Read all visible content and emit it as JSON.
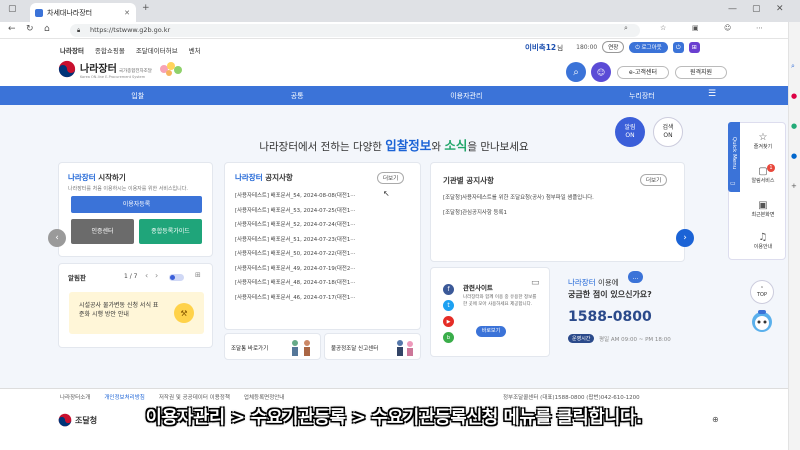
{
  "browser": {
    "tab_title": "차세대나라장터",
    "url": "https://tstwww.g2b.go.kr"
  },
  "site": {
    "top_links": [
      "나라장터",
      "종합쇼핑몰",
      "조달데이터허브",
      "벤처"
    ],
    "user_name": "이비축12",
    "user_suffix": "님",
    "timer": "180:00",
    "extend_label": "연장",
    "logout_label": "로그아웃",
    "logo_title": "나라장터",
    "logo_sub": "국가종합전자조달",
    "logo_sub2": "Korea ON-line E-Procurement System",
    "customer_center": "e-고객센터",
    "remote_support": "원격지원",
    "main_nav": [
      "입찰",
      "공통",
      "이용자관리",
      "누리장터"
    ]
  },
  "hero": {
    "title_pre": "나라장터에서 전하는 다양한 ",
    "title_hl1": "입찰정보",
    "title_mid": "와 ",
    "title_hl2": "소식",
    "title_post": "을 만나보세요",
    "alarm_label": "알림",
    "alarm_state": "ON",
    "search_label": "검색",
    "search_state": "ON"
  },
  "start_card": {
    "title_blue": "나라장터",
    "title_rest": " 시작하기",
    "desc": "나라장터를 처음 이용하시는 이용자를 위한 서비스입니다.",
    "btn_register": "이용자등록",
    "btn_cert": "인증센터",
    "btn_guide": "종합등록가이드"
  },
  "alarm_card": {
    "title": "알림판",
    "pager": "1 / 7",
    "content": "시설공사 물가변동 신청 서식 표준화 시행 방안 안내"
  },
  "notice_card": {
    "title_blue": "나라장터",
    "title_rest": " 공지사항",
    "more": "더보기",
    "items": [
      "[사용자테스트] 배포문서_54, 2024-08-08(대전1···",
      "[사용자테스트] 배포문서_53, 2024-07-25(대전1···",
      "[사용자테스트] 배포문서_52, 2024-07-24(대전1···",
      "[사용자테스트] 배포문서_51, 2024-07-23(대전1···",
      "[사용자테스트] 배포문서_50, 2024-07-22(대전1···",
      "[사용자테스트] 배포문서_49, 2024-07-19(대전2···",
      "[사용자테스트] 배포문서_48, 2024-07-18(대전1···",
      "[사용자테스트] 배포문서_46, 2024-07-17(대전1···"
    ]
  },
  "agency_card": {
    "title": "기관별 공지사항",
    "more": "더보기",
    "items": [
      "[조달청]사용자테스트를 위한 조달요청(공사) 첨부파일 샘플입니다.",
      "[조달청]관심공지사항 등록1"
    ]
  },
  "banners": {
    "left": "조달통 바로가기",
    "right": "불공정조달 신고센터"
  },
  "related": {
    "title": "관련사이트",
    "desc": "나라장터와 함께 이용 중 유용한 정보를 한 곳에 모아 사용하세요 제공합니다.",
    "btn": "바로보기"
  },
  "callcenter": {
    "line1_blue": "나라장터",
    "line1_rest": " 이용에",
    "line2": "궁금한 점이 있으신가요?",
    "phone": "1588-0800",
    "hours_label": "운영시간",
    "hours": "평일 AM 09:00 ~ PM 18:00"
  },
  "quick_menu": {
    "tab_label": "Quick Menu",
    "items": [
      "즐겨찾기",
      "알림서비스",
      "최근본화면",
      "이용안내"
    ],
    "badge": "1",
    "top": "TOP"
  },
  "footer": {
    "links": [
      "나라장터소개",
      "개인정보처리방침",
      "저작권 및 공공데이터 이용정책",
      "업체등록면정안내"
    ],
    "contact": "정부조달콜센터 (대표)1588-0800 (팝번)042-610-1200",
    "org": "조달청"
  },
  "subtitle": "이용자관리 > 수요기관등록 > 수요기관등록신청 메뉴를 클릭합니다.",
  "colors": {
    "brand_blue": "#3b73d8",
    "green": "#1fa57a",
    "dark_gray": "#6b6b6b",
    "callcenter_navy": "#2b4a8b"
  }
}
